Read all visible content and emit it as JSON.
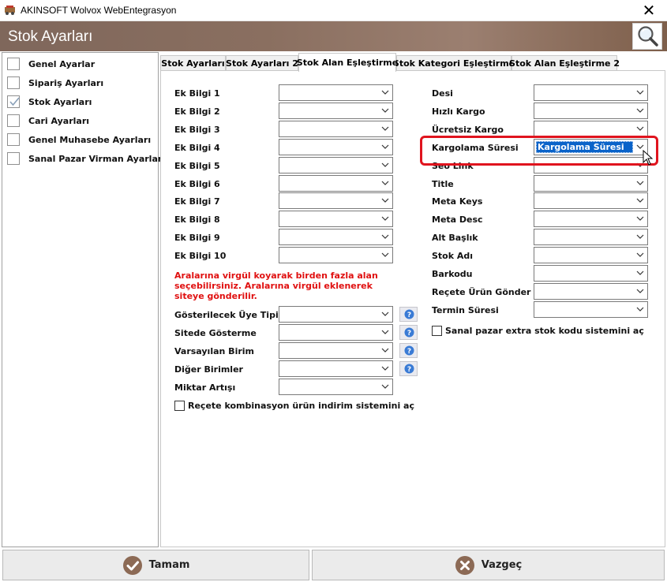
{
  "window": {
    "title": "AKINSOFT Wolvox WebEntegrasyon",
    "close_glyph": "✕"
  },
  "header": {
    "title": "Stok Ayarları"
  },
  "sidebar": {
    "items": [
      {
        "label": "Genel Ayarlar",
        "checked": false
      },
      {
        "label": "Sipariş Ayarları",
        "checked": false
      },
      {
        "label": "Stok Ayarları",
        "checked": true
      },
      {
        "label": "Cari Ayarları",
        "checked": false
      },
      {
        "label": "Genel Muhasebe Ayarları",
        "checked": false
      },
      {
        "label": "Sanal Pazar Virman Ayarları",
        "checked": false
      }
    ]
  },
  "tabs": [
    {
      "label": "Stok Ayarları"
    },
    {
      "label": "Stok Ayarları 2"
    },
    {
      "label": "Stok Alan Eşleştirme",
      "active": true
    },
    {
      "label": "Stok Kategori Eşleştirme"
    },
    {
      "label": "Stok Alan Eşleştirme 2"
    }
  ],
  "left_fields": {
    "ek_bilgi": [
      {
        "label": "Ek Bilgi 1",
        "value": ""
      },
      {
        "label": "Ek Bilgi 2",
        "value": ""
      },
      {
        "label": "Ek Bilgi 3",
        "value": ""
      },
      {
        "label": "Ek Bilgi 4",
        "value": ""
      },
      {
        "label": "Ek Bilgi 5",
        "value": ""
      },
      {
        "label": "Ek Bilgi 6",
        "value": ""
      },
      {
        "label": "Ek Bilgi 7",
        "value": ""
      },
      {
        "label": "Ek Bilgi 8",
        "value": ""
      },
      {
        "label": "Ek Bilgi 9",
        "value": ""
      },
      {
        "label": "Ek Bilgi 10",
        "value": ""
      }
    ],
    "note": "Aralarına virgül koyarak birden fazla alan seçebilirsiniz. Aralarına virgül  eklenerek siteye gönderilir.",
    "unit_fields": [
      {
        "label": "Gösterilecek Üye Tipi",
        "value": ""
      },
      {
        "label": "Sitede Gösterme",
        "value": ""
      },
      {
        "label": "Varsayılan Birim",
        "value": ""
      },
      {
        "label": "Diğer Birimler",
        "value": ""
      },
      {
        "label": "Miktar Artışı",
        "value": ""
      }
    ],
    "recete_checkbox": {
      "label": "Reçete kombinasyon ürün indirim sistemini aç",
      "checked": false
    }
  },
  "right_fields": {
    "items": [
      {
        "label": "Desi",
        "value": ""
      },
      {
        "label": "Hızlı Kargo",
        "value": ""
      },
      {
        "label": "Ücretsiz Kargo",
        "value": ""
      },
      {
        "label": "Kargolama Süresi",
        "value": "Kargolama Süresi"
      },
      {
        "label": "Seo Link",
        "value": ""
      },
      {
        "label": "Title",
        "value": ""
      },
      {
        "label": "Meta Keys",
        "value": ""
      },
      {
        "label": "Meta Desc",
        "value": ""
      },
      {
        "label": "Alt Başlık",
        "value": ""
      },
      {
        "label": "Stok Adı",
        "value": ""
      },
      {
        "label": "Barkodu",
        "value": ""
      },
      {
        "label": "Reçete Ürün Gönder",
        "value": ""
      },
      {
        "label": "Termin Süresi",
        "value": ""
      }
    ],
    "sanal_checkbox": {
      "label": "Sanal pazar extra stok kodu sistemini aç",
      "checked": false
    }
  },
  "buttons": {
    "ok": "Tamam",
    "cancel": "Vazgeç"
  },
  "colors": {
    "header": "#8a6f60",
    "highlight": "#e0141e",
    "note": "#e01010",
    "selection": "#0a63c9"
  }
}
